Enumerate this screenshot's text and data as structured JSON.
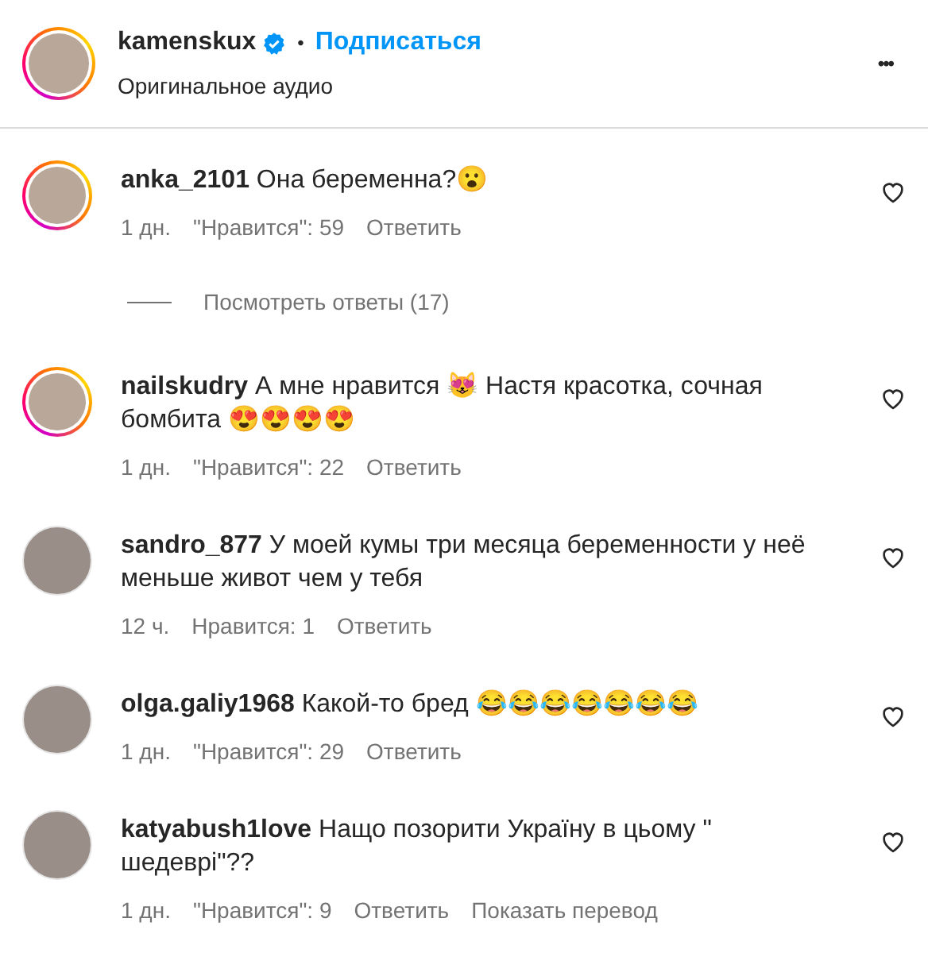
{
  "header": {
    "username": "kamenskux",
    "verified": true,
    "separator": "•",
    "follow": "Подписаться",
    "subtitle": "Оригинальное аудио",
    "story_ring": true,
    "more": "•••"
  },
  "comments": [
    {
      "username": "anka_2101",
      "text": "Она беременна?😮",
      "time": "1 дн.",
      "likes": "\"Нравится\": 59",
      "reply": "Ответить",
      "story_ring": true,
      "view_replies": "Посмотреть ответы (17)"
    },
    {
      "username": "nailskudry",
      "text": "А мне нравится 😻 Настя красотка, сочная бомбита 😍😍😍😍",
      "time": "1 дн.",
      "likes": "\"Нравится\": 22",
      "reply": "Ответить",
      "story_ring": true
    },
    {
      "username": "sandro_877",
      "text": "У моей кумы три месяца беременности у неё меньше живот чем у тебя",
      "time": "12 ч.",
      "likes": "Нравится: 1",
      "reply": "Ответить",
      "story_ring": false
    },
    {
      "username": "olga.galiy1968",
      "text": "Какой-то бред 😂😂😂😂😂😂😂",
      "time": "1 дн.",
      "likes": "\"Нравится\": 29",
      "reply": "Ответить",
      "story_ring": false
    },
    {
      "username": "katyabush1love",
      "text": "Нащо позорити Україну в цьому \" шедеврі\"??",
      "time": "1 дн.",
      "likes": "\"Нравится\": 9",
      "reply": "Ответить",
      "translate": "Показать перевод",
      "story_ring": false
    }
  ]
}
